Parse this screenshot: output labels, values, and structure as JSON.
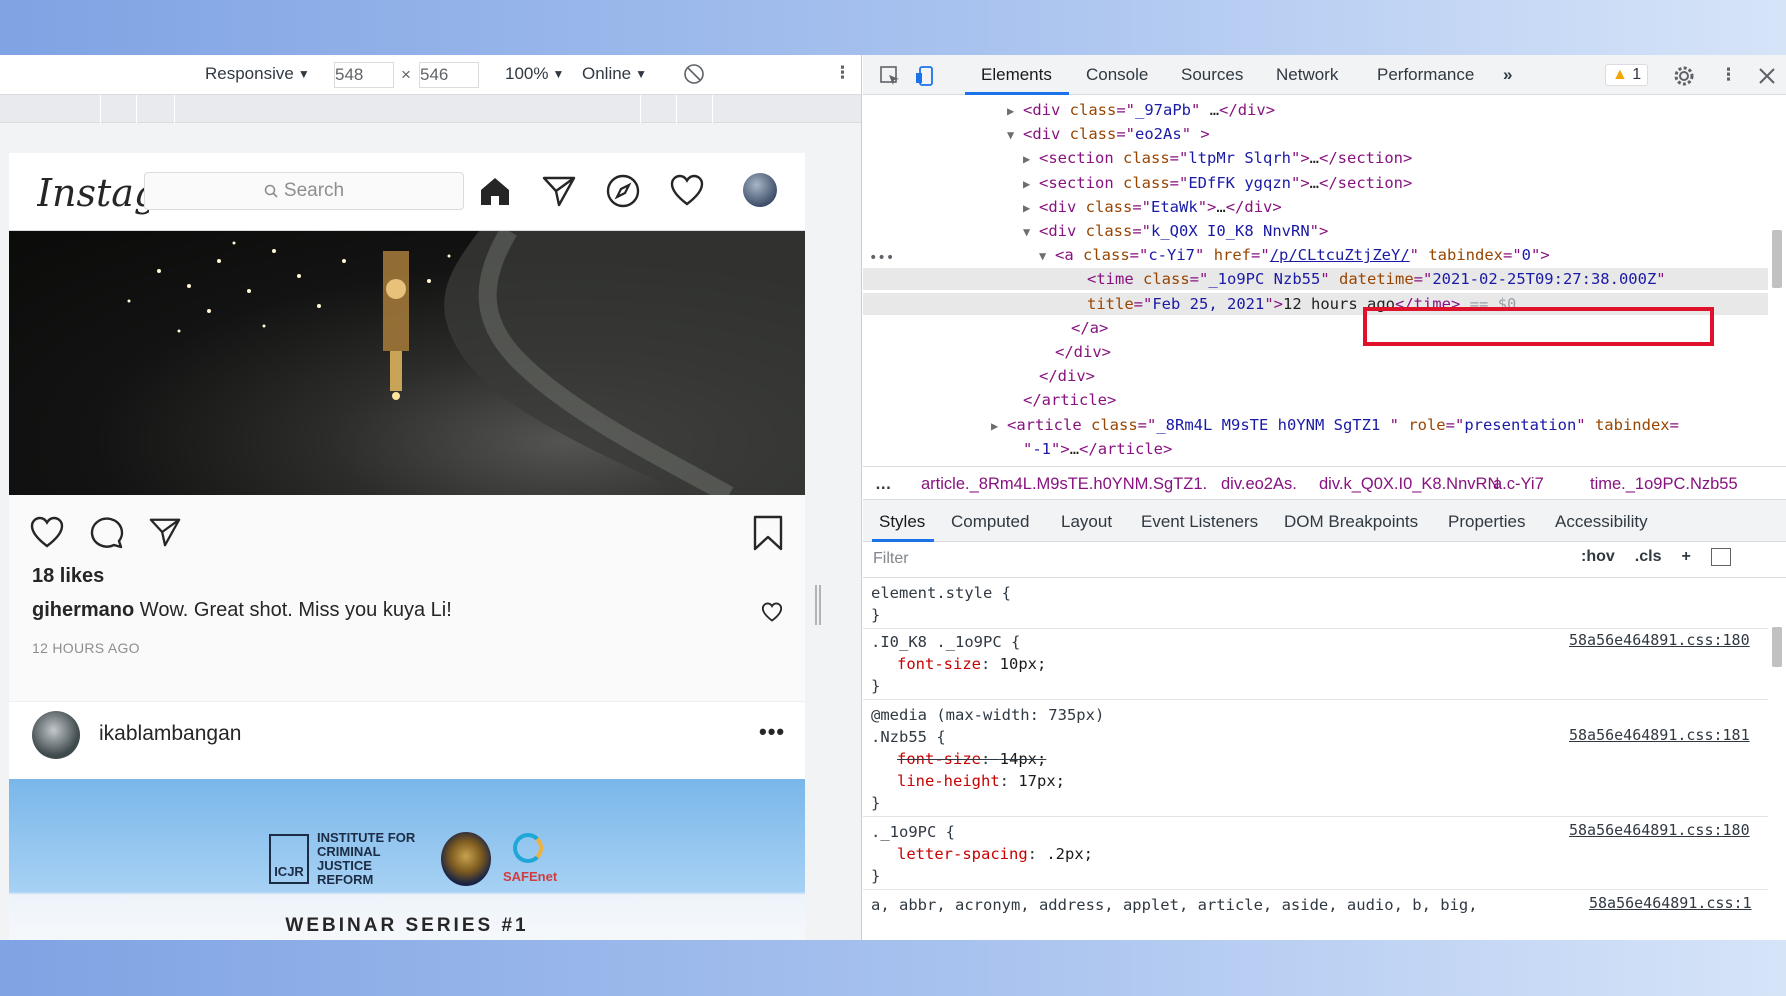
{
  "devbar": {
    "device": "Responsive",
    "width": "548",
    "times": "×",
    "height": "546",
    "zoom": "100%",
    "network": "Online"
  },
  "instagram": {
    "logo": "Instagram",
    "search_placeholder": "Search",
    "likes": "18 likes",
    "comment_user": "gihermano",
    "comment_text": " Wow. Great shot. Miss you kuya Li!",
    "time_ago": "12 HOURS AGO",
    "post2_user": "ikablambangan",
    "more": "•••",
    "banner_org": "INSTITUTE FOR CRIMINAL JUSTICE REFORM",
    "banner_mark": "ICJR",
    "banner_partner": "SAFEnet",
    "webinar": "WEBINAR SERIES #1"
  },
  "devtools": {
    "tabs": [
      "Elements",
      "Console",
      "Sources",
      "Network",
      "Performance"
    ],
    "more_tabs": "»",
    "warnings": "1",
    "dom_lines": [
      {
        "indent": 160,
        "caret": "▶",
        "parts": [
          [
            "tag",
            "<div "
          ],
          [
            "attr",
            "class"
          ],
          [
            "tag",
            "=\""
          ],
          [
            "val",
            "_97aPb"
          ],
          [
            "tag",
            "\" "
          ],
          [
            "txt",
            "…"
          ],
          [
            "tag",
            "</div>"
          ]
        ]
      },
      {
        "indent": 160,
        "caret": "▼",
        "parts": [
          [
            "tag",
            "<div "
          ],
          [
            "attr",
            "class"
          ],
          [
            "tag",
            "=\""
          ],
          [
            "val",
            "eo2As"
          ],
          [
            "tag",
            "\" >"
          ]
        ]
      },
      {
        "indent": 176,
        "caret": "▶",
        "parts": [
          [
            "tag",
            "<section "
          ],
          [
            "attr",
            "class"
          ],
          [
            "tag",
            "=\""
          ],
          [
            "val",
            "ltpMr  Slqrh"
          ],
          [
            "tag",
            "\">"
          ],
          [
            "txt",
            "…"
          ],
          [
            "tag",
            "</section>"
          ]
        ]
      },
      {
        "indent": 176,
        "caret": "▶",
        "parts": [
          [
            "tag",
            "<section "
          ],
          [
            "attr",
            "class"
          ],
          [
            "tag",
            "=\""
          ],
          [
            "val",
            "EDfFK ygqzn"
          ],
          [
            "tag",
            "\">"
          ],
          [
            "txt",
            "…"
          ],
          [
            "tag",
            "</section>"
          ]
        ]
      },
      {
        "indent": 176,
        "caret": "▶",
        "parts": [
          [
            "tag",
            "<div "
          ],
          [
            "attr",
            "class"
          ],
          [
            "tag",
            "=\""
          ],
          [
            "val",
            "EtaWk"
          ],
          [
            "tag",
            "\">"
          ],
          [
            "txt",
            "…"
          ],
          [
            "tag",
            "</div>"
          ]
        ]
      },
      {
        "indent": 176,
        "caret": "▼",
        "parts": [
          [
            "tag",
            "<div "
          ],
          [
            "attr",
            "class"
          ],
          [
            "tag",
            "=\""
          ],
          [
            "val",
            "k_Q0X I0_K8  NnvRN"
          ],
          [
            "tag",
            "\">"
          ]
        ]
      },
      {
        "indent": 192,
        "caret": "▼",
        "parts": [
          [
            "tag",
            "<a "
          ],
          [
            "attr",
            "class"
          ],
          [
            "tag",
            "=\""
          ],
          [
            "val",
            "c-Yi7"
          ],
          [
            "tag",
            "\" "
          ],
          [
            "attr",
            "href"
          ],
          [
            "tag",
            "=\""
          ],
          [
            "link",
            "/p/CLtcuZtjZeY/"
          ],
          [
            "tag",
            "\" "
          ],
          [
            "attr",
            "tabindex"
          ],
          [
            "tag",
            "=\""
          ],
          [
            "val",
            "0"
          ],
          [
            "tag",
            "\">"
          ]
        ]
      },
      {
        "indent": 224,
        "caret": "",
        "selected": true,
        "parts": [
          [
            "tag",
            "<time "
          ],
          [
            "attr",
            "class"
          ],
          [
            "tag",
            "=\""
          ],
          [
            "val",
            "_1o9PC Nzb55"
          ],
          [
            "tag",
            "\" "
          ],
          [
            "attr",
            "datetime"
          ],
          [
            "tag",
            "=\""
          ],
          [
            "val",
            "2021-02-25T09:27:38.000Z"
          ],
          [
            "tag",
            "\""
          ]
        ]
      },
      {
        "indent": 224,
        "caret": "",
        "selected": true,
        "parts": [
          [
            "attr",
            "title"
          ],
          [
            "tag",
            "=\""
          ],
          [
            "val",
            "Feb 25, 2021"
          ],
          [
            "tag",
            "\">"
          ],
          [
            "txt",
            "12 hours ago"
          ],
          [
            "tag",
            "</time>"
          ],
          [
            "dollar",
            " == $0"
          ]
        ]
      },
      {
        "indent": 208,
        "caret": "",
        "parts": [
          [
            "tag",
            "</a>"
          ]
        ]
      },
      {
        "indent": 192,
        "caret": "",
        "parts": [
          [
            "tag",
            "</div>"
          ]
        ]
      },
      {
        "indent": 176,
        "caret": "",
        "parts": [
          [
            "tag",
            "</div>"
          ]
        ]
      },
      {
        "indent": 160,
        "caret": "",
        "parts": [
          [
            "tag",
            "</article>"
          ]
        ]
      },
      {
        "indent": 144,
        "caret": "▶",
        "parts": [
          [
            "tag",
            "<article "
          ],
          [
            "attr",
            "class"
          ],
          [
            "tag",
            "=\""
          ],
          [
            "val",
            "_8Rm4L M9sTE h0YNM  SgTZ1   "
          ],
          [
            "tag",
            "\" "
          ],
          [
            "attr",
            "role"
          ],
          [
            "tag",
            "=\""
          ],
          [
            "val",
            "presentation"
          ],
          [
            "tag",
            "\" "
          ],
          [
            "attr",
            "tabindex"
          ],
          [
            "tag",
            "="
          ]
        ]
      },
      {
        "indent": 160,
        "caret": "",
        "parts": [
          [
            "tag",
            "\""
          ],
          [
            "val",
            "-1"
          ],
          [
            "tag",
            "\">"
          ],
          [
            "txt",
            "…"
          ],
          [
            "tag",
            "</article>"
          ]
        ]
      },
      {
        "indent": 144,
        "caret": "▶",
        "parts": [
          [
            "tag",
            "<article "
          ],
          [
            "attr",
            "class"
          ],
          [
            "tag",
            "=\""
          ],
          [
            "val",
            "_8Rm4L M9sTE h0YNM  SgTZ1   "
          ],
          [
            "tag",
            "\" "
          ],
          [
            "attr",
            "role"
          ],
          [
            "tag",
            "=\""
          ],
          [
            "val",
            "presentation"
          ],
          [
            "tag",
            "\" "
          ],
          [
            "attr",
            "tabindex"
          ],
          [
            "tag",
            "="
          ]
        ]
      }
    ],
    "breadcrumbs": [
      "article._8Rm4L.M9sTE.h0YNM.SgTZ1.",
      "div.eo2As.",
      "div.k_Q0X.I0_K8.NnvRN",
      "a.c-Yi7",
      "time._1o9PC.Nzb55"
    ],
    "sub_tabs": [
      "Styles",
      "Computed",
      "Layout",
      "Event Listeners",
      "DOM Breakpoints",
      "Properties",
      "Accessibility"
    ],
    "filter_placeholder": "Filter",
    "filter_hov": ":hov",
    "filter_cls": ".cls",
    "filter_plus": "+",
    "styles": {
      "element_style": "element.style {",
      "close": "}",
      "r1_selector": ".I0_K8 ._1o9PC {",
      "r1_src": "58a56e464891.css:180",
      "r1_prop": "font-size",
      "r1_val": "10px;",
      "media": "@media (max-width: 735px)",
      "r2_selector": ".Nzb55 {",
      "r2_src": "58a56e464891.css:181",
      "r2_prop1": "font-size",
      "r2_val1": "14px;",
      "r2_prop2": "line-height",
      "r2_val2": "17px;",
      "r3_selector": "._1o9PC {",
      "r3_src": "58a56e464891.css:180",
      "r3_prop": "letter-spacing",
      "r3_val": ".2px;",
      "r4_selector": "a, abbr, acronym, address, applet, article, aside, audio, b, big,",
      "r4_src": "58a56e464891.css:1"
    }
  }
}
